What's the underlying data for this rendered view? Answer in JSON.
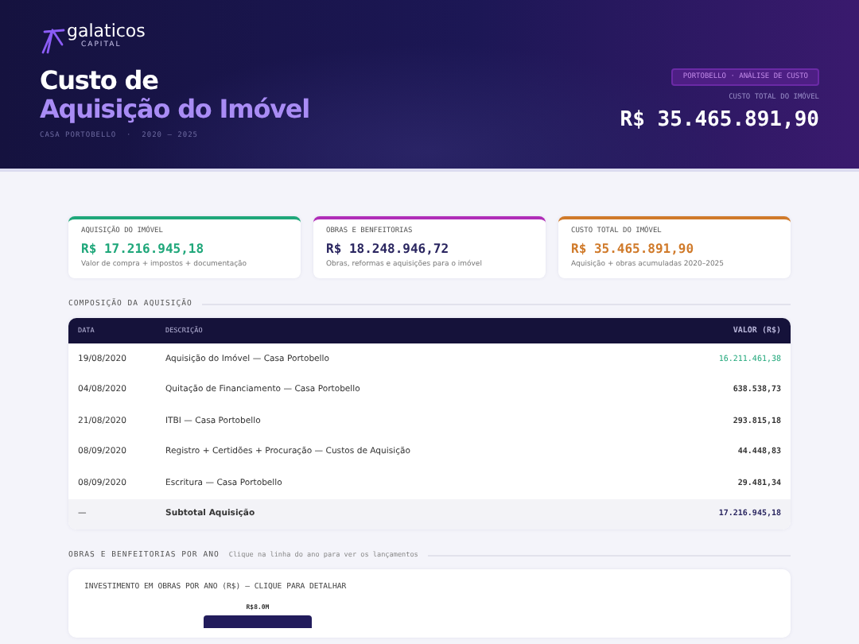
{
  "header": {
    "brand": "galaticos",
    "brand_sub": "CAPITAL",
    "title_line1": "Custo de",
    "title_line2": "Aquisição do Imóvel",
    "subtitle": "CASA PORTOBELLO  ·  2020 – 2025",
    "badge": "PORTOBELLO · ANÁLISE DE CUSTO",
    "total_label": "CUSTO TOTAL DO IMÓVEL",
    "total_value": "R$ 35.465.891,90"
  },
  "summary_cards": [
    {
      "label": "AQUISIÇÃO DO IMÓVEL",
      "value": "R$ 17.216.945,18",
      "note": "Valor de compra + impostos + documentação",
      "color": "#1fa77a"
    },
    {
      "label": "OBRAS E BENFEITORIAS",
      "value": "R$ 18.248.946,72",
      "note": "Obras, reformas e aquisições para o imóvel",
      "color": "#b02db8"
    },
    {
      "label": "CUSTO TOTAL DO IMÓVEL",
      "value": "R$ 35.465.891,90",
      "note": "Aquisição + obras acumuladas 2020–2025",
      "color": "#d07a2a"
    }
  ],
  "composition": {
    "title": "COMPOSIÇÃO DA AQUISIÇÃO",
    "columns": [
      "DATA",
      "DESCRIÇÃO",
      "VALOR (R$)"
    ],
    "rows": [
      {
        "kind": "item",
        "date": "19/08/2020",
        "description": "Aquisição do Imóvel — Casa Portobello",
        "value": "16.211.461,38",
        "highlight": true
      },
      {
        "kind": "item",
        "date": "04/08/2020",
        "description": "Quitação de Financiamento — Casa Portobello",
        "value": "638.538,73",
        "highlight": false
      },
      {
        "kind": "item",
        "date": "21/08/2020",
        "description": "ITBI — Casa Portobello",
        "value": "293.815,18",
        "highlight": false
      },
      {
        "kind": "item",
        "date": "08/09/2020",
        "description": "Registro + Certidões + Procuração — Custos de Aquisição",
        "value": "44.448,83",
        "highlight": false
      },
      {
        "kind": "item",
        "date": "08/09/2020",
        "description": "Escritura — Casa Portobello",
        "value": "29.481,34",
        "highlight": false
      },
      {
        "kind": "subtotal",
        "date": "—",
        "description": "Subtotal Aquisição",
        "value": "17.216.945,18",
        "highlight": false
      }
    ]
  },
  "works": {
    "title": "OBRAS E BENFEITORIAS POR ANO",
    "hint": "Clique na linha do ano para ver os lançamentos",
    "chart": {
      "title": "INVESTIMENTO EM OBRAS POR ANO (R$) — CLIQUE PARA DETALHAR",
      "bar_label": "R$8.0M"
    }
  }
}
